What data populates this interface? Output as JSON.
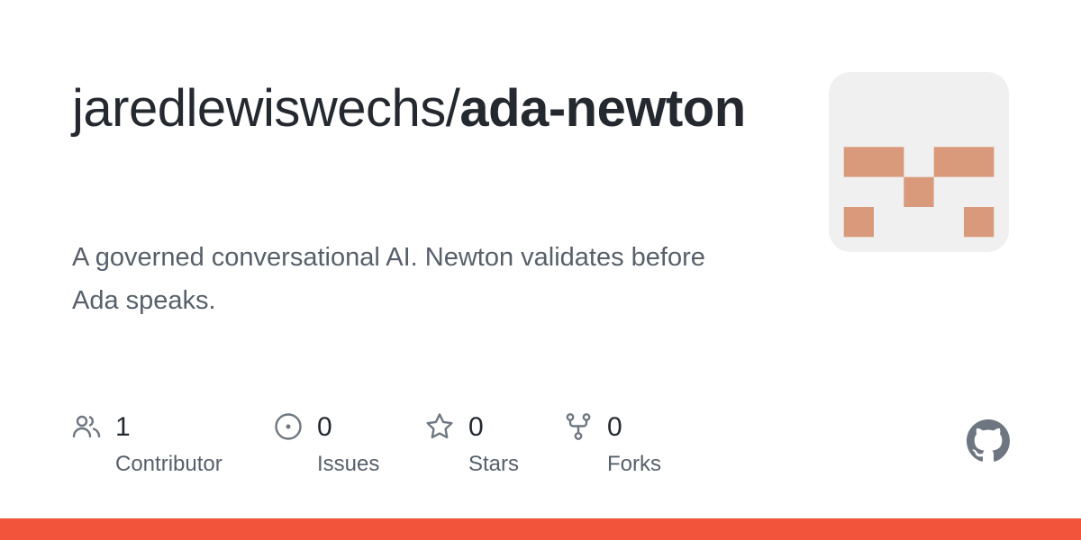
{
  "repo": {
    "owner_prefix": "jaredlewiswechs/",
    "name": "ada-newton",
    "description": "A governed conversational AI. Newton validates before Ada speaks."
  },
  "stats": [
    {
      "count": "1",
      "label": "Contributor",
      "icon": "people-icon"
    },
    {
      "count": "0",
      "label": "Issues",
      "icon": "issue-opened-icon"
    },
    {
      "count": "0",
      "label": "Stars",
      "icon": "star-icon"
    },
    {
      "count": "0",
      "label": "Forks",
      "icon": "repo-forked-icon"
    }
  ],
  "colors": {
    "title": "#24292f",
    "muted": "#57606a",
    "icon": "#6e7781",
    "avatar_bg": "#f0f0f0",
    "avatar_pattern": "#d99a7c",
    "language_bar": "#f1533b"
  }
}
